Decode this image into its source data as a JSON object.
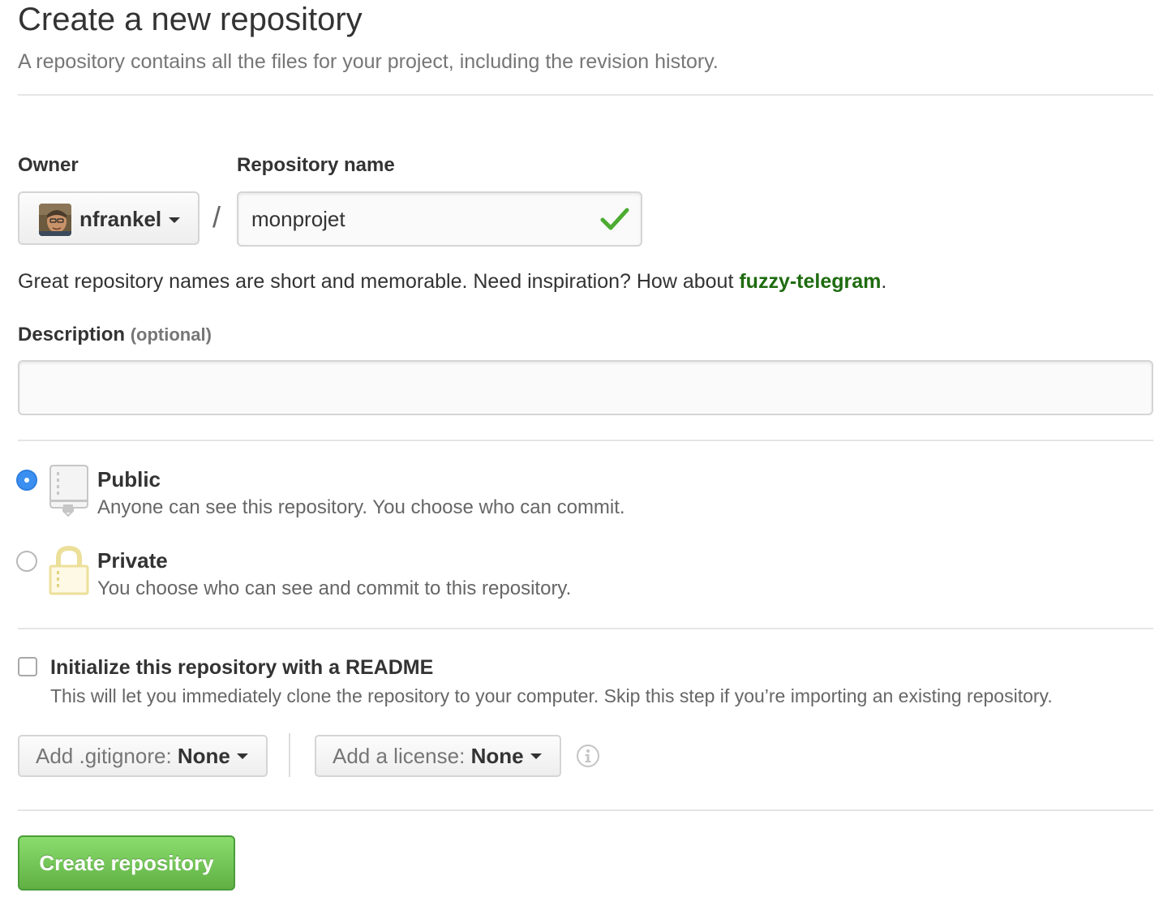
{
  "header": {
    "title": "Create a new repository",
    "subtitle": "A repository contains all the files for your project, including the revision history."
  },
  "owner": {
    "label": "Owner",
    "value": "nfrankel",
    "icon": "avatar"
  },
  "separator": "/",
  "repo_name": {
    "label": "Repository name",
    "value": "monprojet",
    "status_icon": "check-icon"
  },
  "hint": {
    "text": "Great repository names are short and memorable. Need inspiration? How about ",
    "suggestion": "fuzzy-telegram",
    "suffix": "."
  },
  "description": {
    "label": "Description",
    "optional": "(optional)",
    "value": ""
  },
  "visibility": {
    "selected": "public",
    "options": [
      {
        "id": "public",
        "title": "Public",
        "description": "Anyone can see this repository. You choose who can commit.",
        "icon": "repo-book-icon"
      },
      {
        "id": "private",
        "title": "Private",
        "description": "You choose who can see and commit to this repository.",
        "icon": "lock-icon"
      }
    ]
  },
  "readme": {
    "checked": false,
    "label": "Initialize this repository with a README",
    "description": "This will let you immediately clone the repository to your computer. Skip this step if you’re importing an existing repository."
  },
  "gitignore": {
    "prefix": "Add .gitignore: ",
    "value": "None"
  },
  "license": {
    "prefix": "Add a license: ",
    "value": "None",
    "info_icon": "info-icon"
  },
  "submit": {
    "label": "Create repository"
  },
  "colors": {
    "accent_green": "#60b044",
    "suggestion_green": "#1e6b0f",
    "radio_blue": "#3b8ff1",
    "check_green": "#4cac32",
    "lock_yellow": "#ecdf9a"
  }
}
